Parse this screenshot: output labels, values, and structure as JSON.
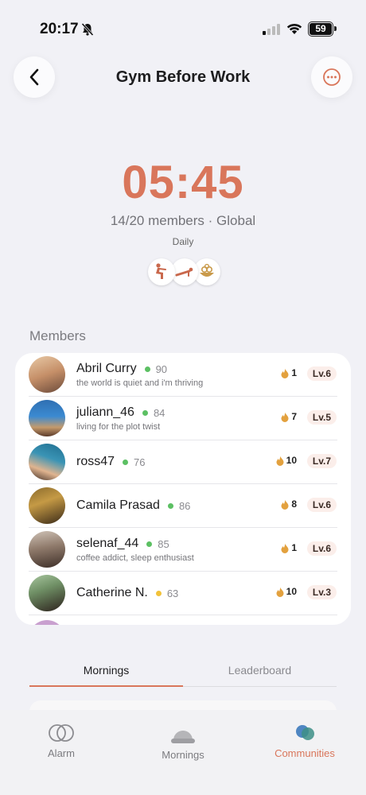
{
  "status_bar": {
    "time": "20:17",
    "battery": "59"
  },
  "header": {
    "title": "Gym Before Work"
  },
  "alarm": {
    "time": "05:45",
    "members_info": "14/20 members · Global",
    "frequency": "Daily"
  },
  "activities": [
    {
      "icon": "squat-icon"
    },
    {
      "icon": "plank-icon"
    },
    {
      "icon": "breakfast-bowl-icon"
    }
  ],
  "members_section": {
    "label": "Members"
  },
  "members": [
    {
      "name": "Abril Curry",
      "status_color": "#5cc063",
      "score": "90",
      "bio": "the world is quiet and i'm thriving",
      "streak": "1",
      "level": "Lv.6"
    },
    {
      "name": "juliann_46",
      "status_color": "#5cc063",
      "score": "84",
      "bio": "living for the plot twist",
      "streak": "7",
      "level": "Lv.5"
    },
    {
      "name": "ross47",
      "status_color": "#5cc063",
      "score": "76",
      "bio": "",
      "streak": "10",
      "level": "Lv.7"
    },
    {
      "name": "Camila Prasad",
      "status_color": "#5cc063",
      "score": "86",
      "bio": "",
      "streak": "8",
      "level": "Lv.6"
    },
    {
      "name": "selenaf_44",
      "status_color": "#5cc063",
      "score": "85",
      "bio": "coffee addict, sleep enthusiast",
      "streak": "1",
      "level": "Lv.6"
    },
    {
      "name": "Catherine N.",
      "status_color": "#f2c23a",
      "score": "63",
      "bio": "",
      "streak": "10",
      "level": "Lv.3"
    }
  ],
  "tabs": {
    "mornings": "Mornings",
    "leaderboard": "Leaderboard"
  },
  "nav": {
    "alarm": "Alarm",
    "mornings": "Mornings",
    "communities": "Communities"
  },
  "colors": {
    "accent": "#d9765b",
    "level_bg": "#fbeeea",
    "flame": "#e3a13e"
  }
}
